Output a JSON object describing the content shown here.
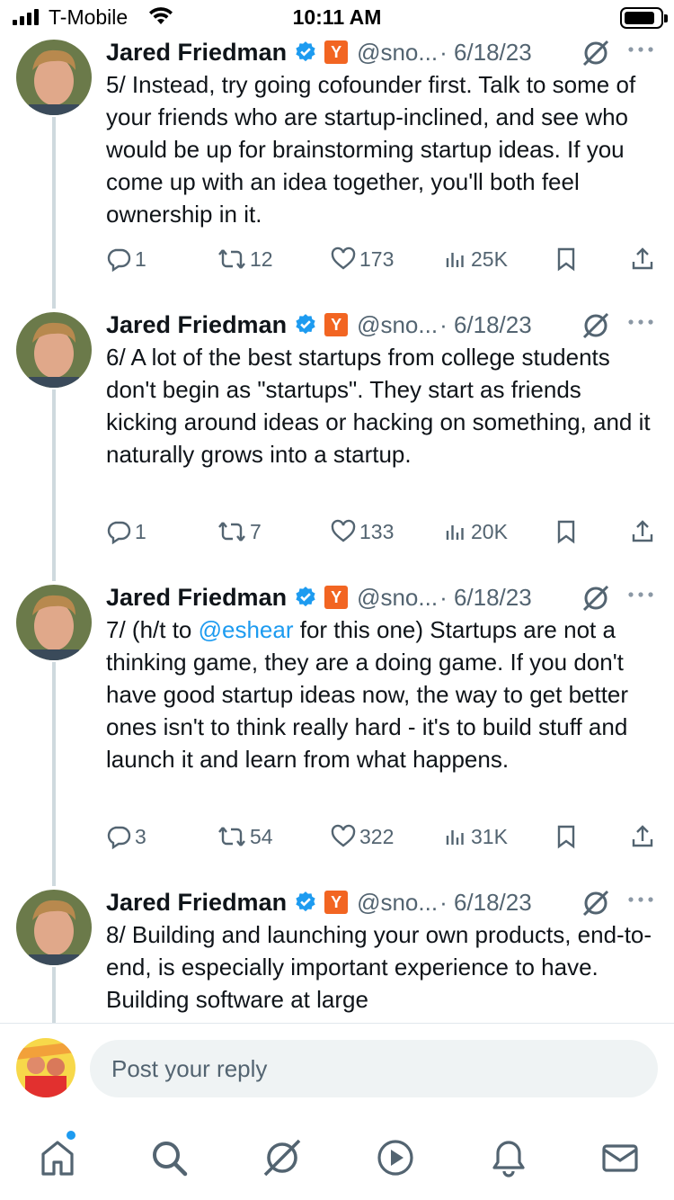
{
  "status_bar": {
    "carrier": "T-Mobile",
    "time": "10:11 AM"
  },
  "tweets": [
    {
      "author": "Jared Friedman",
      "badge": "Y",
      "handle": "@sno...",
      "date": "· 6/18/23",
      "text": "5/ Instead, try going cofounder first.  Talk to some of your friends who are startup-inclined, and see who would be up for brainstorming startup ideas.  If you come up with an idea together, you'll both feel ownership in it.",
      "replies": "1",
      "reposts": "12",
      "likes": "173",
      "views": "25K"
    },
    {
      "author": "Jared Friedman",
      "badge": "Y",
      "handle": "@sno...",
      "date": "· 6/18/23",
      "text": "6/ A lot of the best startups from college students don't begin as \"startups\".  They start as friends kicking around ideas or hacking on something, and it naturally grows into  a startup.",
      "replies": "1",
      "reposts": "7",
      "likes": "133",
      "views": "20K"
    },
    {
      "author": "Jared Friedman",
      "badge": "Y",
      "handle": "@sno...",
      "date": "· 6/18/23",
      "text_before": "7/ (h/t to ",
      "mention": "@eshear",
      "text_after": " for this one) Startups are not a thinking game, they are a doing game. If you don't have good startup ideas now, the way to get better ones isn't to think really hard - it's to build stuff and launch it and learn from what happens.",
      "replies": "3",
      "reposts": "54",
      "likes": "322",
      "views": "31K"
    },
    {
      "author": "Jared Friedman",
      "badge": "Y",
      "handle": "@sno...",
      "date": "· 6/18/23",
      "text": "8/ Building and launching your own products, end-to-end, is especially important experience to have.  Building software at large"
    }
  ],
  "reply_bar": {
    "placeholder": "Post your reply"
  },
  "bottom_nav": {
    "items": [
      "home-icon",
      "search-icon",
      "grok-icon",
      "video-icon",
      "notifications-icon",
      "messages-icon"
    ]
  },
  "colors": {
    "accent": "#1d9bf0",
    "muted": "#536471",
    "text": "#0f1419",
    "thread_line": "#cfd9de",
    "yc_orange": "#f26522"
  }
}
